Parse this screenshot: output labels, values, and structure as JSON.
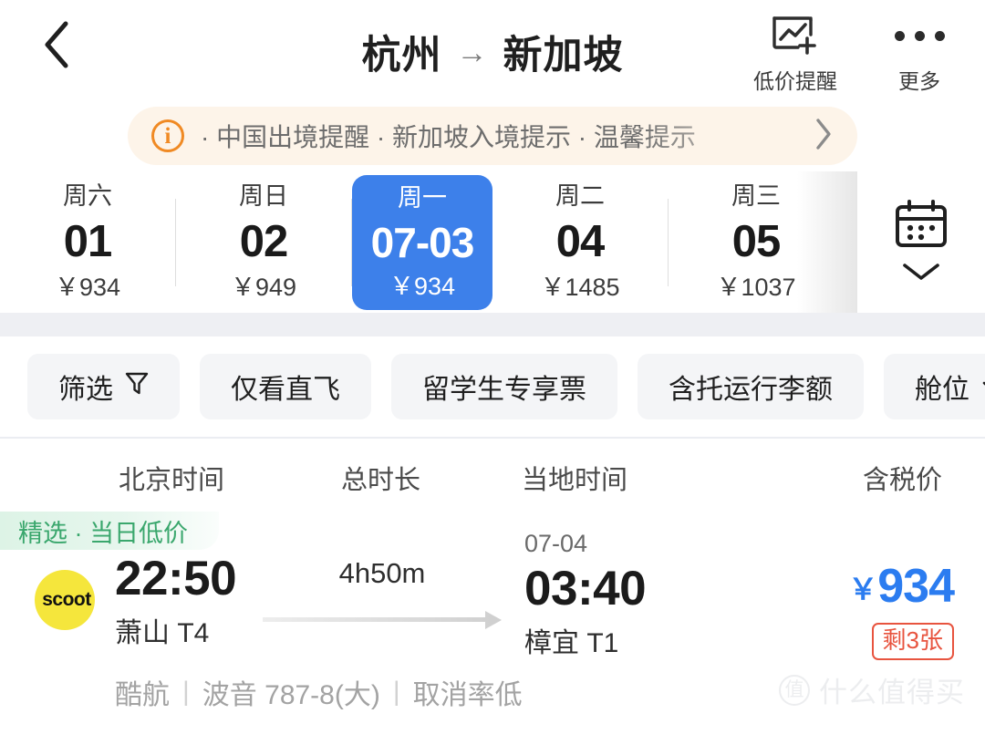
{
  "header": {
    "back_icon": "chevron-left-icon",
    "origin": "杭州",
    "arrow": "→",
    "destination": "新加坡",
    "price_alert_icon": "chart-plus-icon",
    "price_alert_label": "低价提醒",
    "more_icon": "ellipsis-icon",
    "more_label": "更多"
  },
  "notice": {
    "icon": "info-circle-icon",
    "text": "· 中国出境提醒 · 新加坡入境提示 · 温馨提示",
    "chevron_icon": "chevron-right-icon",
    "accent_color": "#f08a24",
    "background_color": "#fdf4e9"
  },
  "dates": {
    "selected_color": "#3d80ea",
    "items": [
      {
        "dow": "周六",
        "day": "01",
        "price": "￥934",
        "selected": false
      },
      {
        "dow": "周日",
        "day": "02",
        "price": "￥949",
        "selected": false
      },
      {
        "dow": "周一",
        "day": "07-03",
        "price": "￥934",
        "selected": true
      },
      {
        "dow": "周二",
        "day": "04",
        "price": "￥1485",
        "selected": false
      },
      {
        "dow": "周三",
        "day": "05",
        "price": "￥1037",
        "selected": false
      }
    ],
    "calendar_icon": "calendar-icon",
    "calendar_chevron_icon": "chevron-down-icon"
  },
  "filters": [
    {
      "label": "筛选",
      "icon": "funnel-icon"
    },
    {
      "label": "仅看直飞",
      "icon": null
    },
    {
      "label": "留学生专享票",
      "icon": null
    },
    {
      "label": "含托运行李额",
      "icon": null
    },
    {
      "label": "舱位",
      "icon": "chevron-down-icon"
    }
  ],
  "columns": [
    "北京时间",
    "总时长",
    "当地时间",
    "含税价"
  ],
  "flight": {
    "promo_badge": "精选 · 当日低价",
    "promo_color": "#3aa76d",
    "airline_logo_text": "scoot",
    "airline_logo_color": "#f5e63c",
    "depart_time": "22:50",
    "depart_airport": "萧山 T4",
    "duration": "4h50m",
    "arrive_date": "07-04",
    "arrive_time": "03:40",
    "arrive_airport": "樟宜 T1",
    "price_currency": "￥",
    "price_value": "934",
    "price_color": "#2b7cf0",
    "seats_left": "剩3张",
    "seats_color": "#e8543f",
    "airline_name": "酷航",
    "aircraft": "波音 787-8(大)",
    "cancel_rate": "取消率低",
    "divider": "|"
  },
  "watermark": {
    "mark": "值",
    "text": "什么值得买"
  }
}
